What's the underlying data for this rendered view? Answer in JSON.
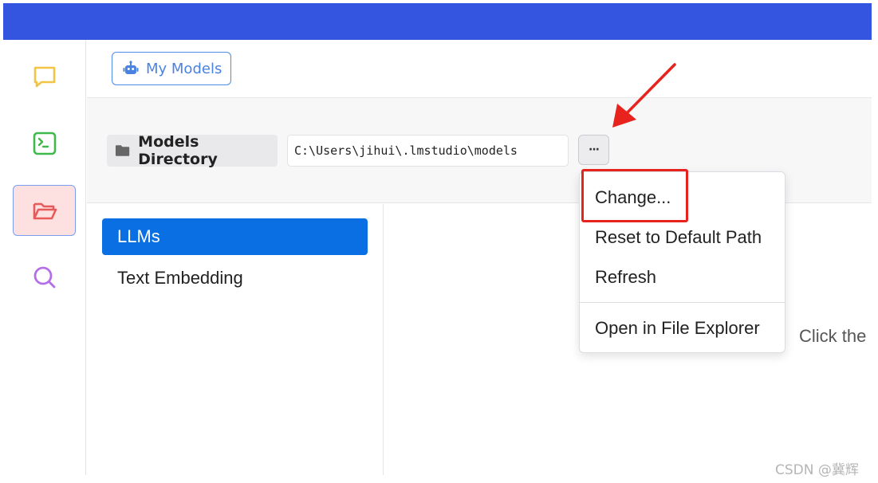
{
  "colors": {
    "topbar": "#3355e0",
    "accent": "#0b6fe4",
    "annotation": "#e8231e",
    "chat_icon": "#f2c443",
    "terminal_icon": "#3fb94b",
    "folder_icon": "#e85a5a",
    "search_icon": "#b46ee6"
  },
  "sidebar": {
    "items": [
      {
        "icon": "chat-icon"
      },
      {
        "icon": "terminal-icon"
      },
      {
        "icon": "folder-icon",
        "active": true
      },
      {
        "icon": "search-icon"
      }
    ]
  },
  "toolbar": {
    "my_models_label": "My Models",
    "my_models_icon": "robot-icon"
  },
  "models_directory": {
    "label": "Models Directory",
    "path": "C:\\Users\\jihui\\.lmstudio\\models",
    "more_button": "···"
  },
  "categories": [
    {
      "label": "LLMs",
      "active": true
    },
    {
      "label": "Text Embedding",
      "active": false
    }
  ],
  "context_menu": {
    "items": [
      {
        "label": "Change..."
      },
      {
        "label": "Reset to Default Path"
      },
      {
        "label": "Refresh"
      },
      {
        "label": "Open in File Explorer"
      }
    ]
  },
  "main": {
    "hint": "Click the"
  },
  "watermark": "CSDN @冀辉"
}
